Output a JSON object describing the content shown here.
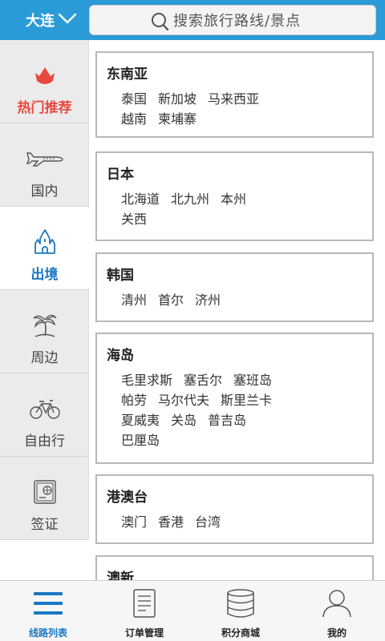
{
  "header": {
    "city": "大连",
    "search_placeholder": "搜索旅行路线/景点"
  },
  "sidebar": {
    "items": [
      {
        "label": "热门推荐",
        "icon": "flame-icon"
      },
      {
        "label": "国内",
        "icon": "airplane-icon"
      },
      {
        "label": "出境",
        "icon": "castle-icon"
      },
      {
        "label": "周边",
        "icon": "palm-tree-icon"
      },
      {
        "label": "自由行",
        "icon": "bicycle-icon"
      },
      {
        "label": "签证",
        "icon": "passport-icon"
      }
    ],
    "active_index": 2
  },
  "regions": [
    {
      "title": "东南亚",
      "rows": [
        [
          "泰国",
          "新加坡",
          "马来西亚"
        ],
        [
          "越南",
          "柬埔寨"
        ]
      ]
    },
    {
      "title": "日本",
      "rows": [
        [
          "北海道",
          "北九州",
          "本州"
        ],
        [
          "关西"
        ]
      ]
    },
    {
      "title": "韩国",
      "rows": [
        [
          "清州",
          "首尔",
          "济州"
        ]
      ]
    },
    {
      "title": "海岛",
      "rows": [
        [
          "毛里求斯",
          "塞舌尔",
          "塞班岛"
        ],
        [
          "帕劳",
          "马尔代夫",
          "斯里兰卡"
        ],
        [
          "夏威夷",
          "关岛",
          "普吉岛"
        ],
        [
          "巴厘岛"
        ]
      ]
    },
    {
      "title": "港澳台",
      "rows": [
        [
          "澳门",
          "香港",
          "台湾"
        ]
      ]
    },
    {
      "title": "澳新",
      "rows": []
    }
  ],
  "tabbar": {
    "tabs": [
      {
        "label": "线路列表",
        "icon": "list-icon"
      },
      {
        "label": "订单管理",
        "icon": "document-icon"
      },
      {
        "label": "积分商城",
        "icon": "database-icon"
      },
      {
        "label": "我的",
        "icon": "user-icon"
      }
    ],
    "active_index": 0
  },
  "colors": {
    "header_bg": "#2b9bd8",
    "active_blue": "#1a78c2",
    "hot_red": "#e8493f",
    "sidebar_bg": "#ecebeb"
  }
}
